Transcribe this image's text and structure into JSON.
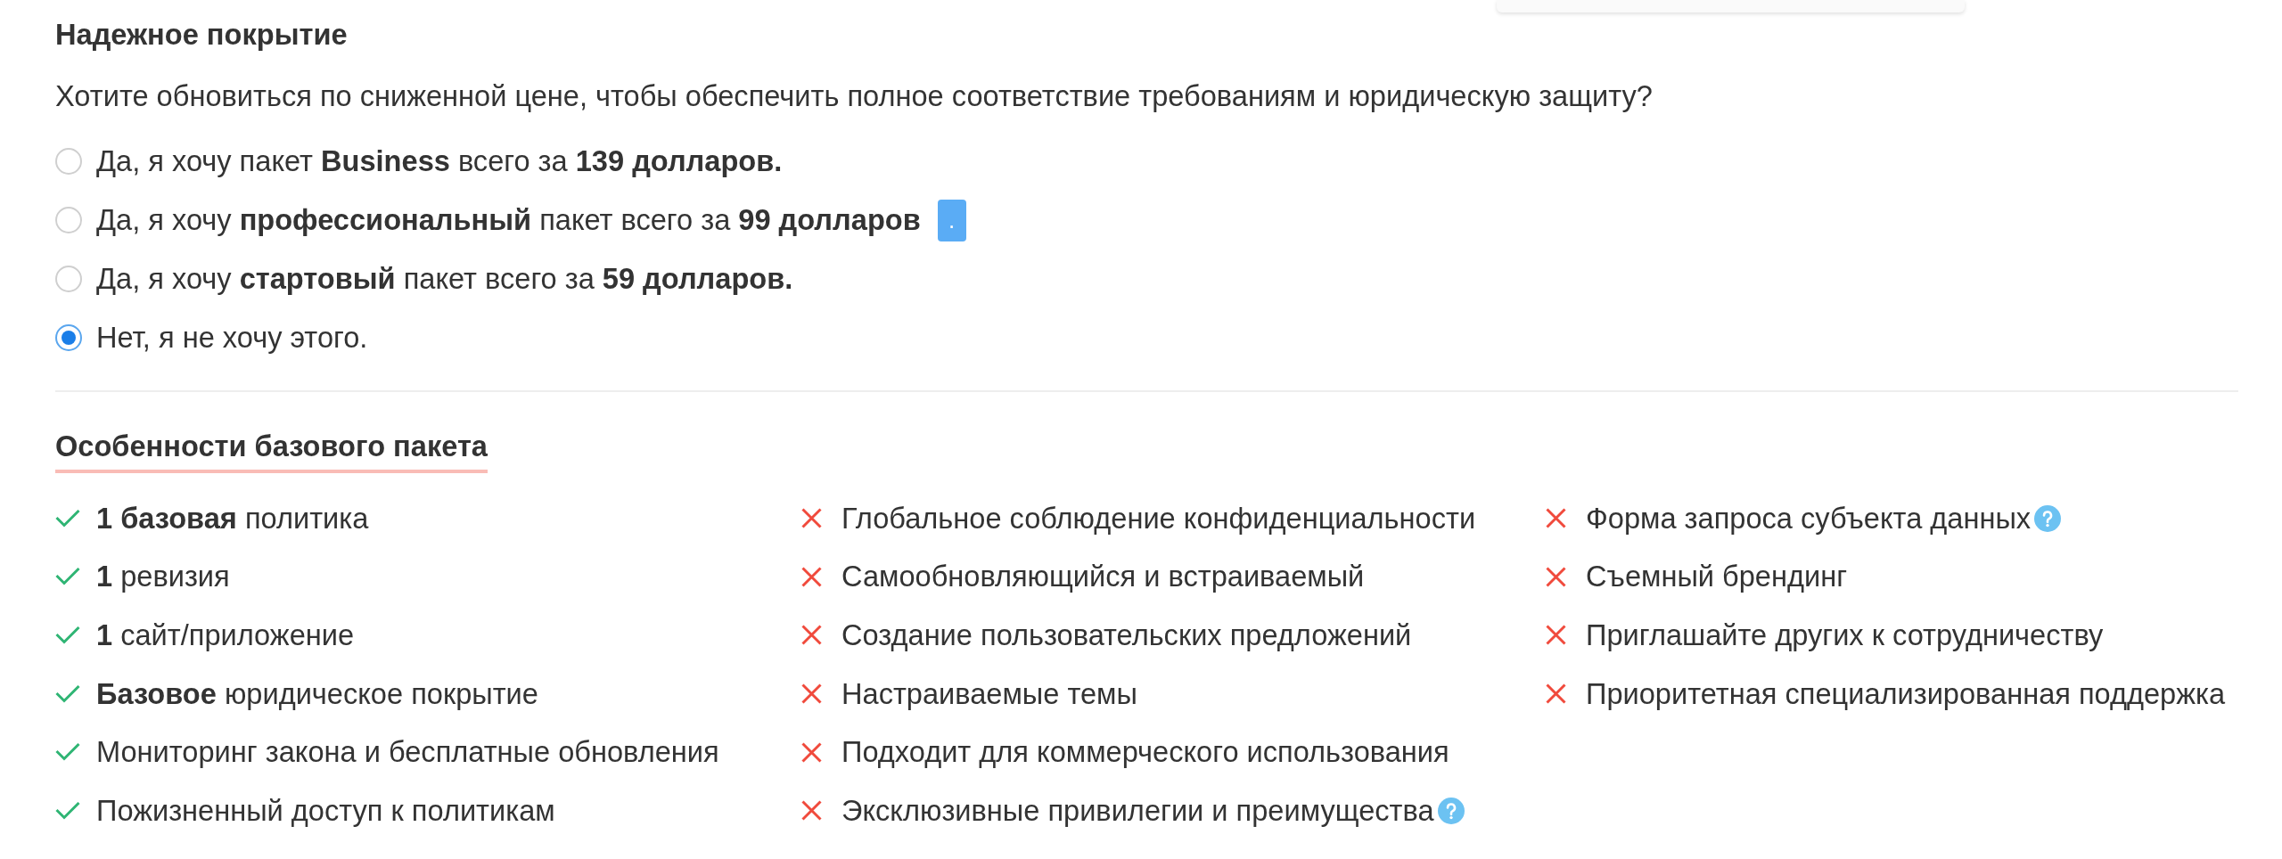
{
  "upgrade": {
    "title": "Надежное покрытие",
    "question": "Хотите обновиться по сниженной цене, чтобы обеспечить полное соответствие требованиям и юридическую защиту?",
    "options": [
      {
        "label": "Да, я хочу пакет **Business** всего за **139 долларов.**",
        "selected": false
      },
      {
        "label": "Да, я хочу **профессиональный** пакет всего за **99 долларов**",
        "badge": ".",
        "selected": false
      },
      {
        "label": "Да, я хочу **стартовый** пакет всего за **59 долларов.**",
        "selected": false
      },
      {
        "label": "Нет, я не хочу этого.",
        "selected": true
      }
    ]
  },
  "features": {
    "title": "Особенности базового пакета",
    "columns": [
      {
        "items": [
          {
            "text": "**1 базовая** политика",
            "included": true,
            "help": false
          },
          {
            "text": "**1** ревизия",
            "included": true,
            "help": false
          },
          {
            "text": "**1** сайт/приложение",
            "included": true,
            "help": false
          },
          {
            "text": "**Базовое** юридическое покрытие",
            "included": true,
            "help": false
          },
          {
            "text": "Мониторинг закона и бесплатные обновления",
            "included": true,
            "help": false
          },
          {
            "text": "Пожизненный доступ к политикам",
            "included": true,
            "help": false
          }
        ]
      },
      {
        "items": [
          {
            "text": "Глобальное соблюдение конфиденциальности",
            "included": false,
            "help": false
          },
          {
            "text": "Самообновляющийся и встраиваемый",
            "included": false,
            "help": false
          },
          {
            "text": "Создание пользовательских предложений",
            "included": false,
            "help": false
          },
          {
            "text": "Настраиваемые темы",
            "included": false,
            "help": false
          },
          {
            "text": "Подходит для коммерческого использования",
            "included": false,
            "help": false
          },
          {
            "text": "Эксклюзивные привилегии и преимущества",
            "included": false,
            "help": true
          }
        ]
      },
      {
        "items": [
          {
            "text": "Форма запроса субъекта данных",
            "included": false,
            "help": true
          },
          {
            "text": "Съемный брендинг",
            "included": false,
            "help": false
          },
          {
            "text": "Приглашайте других к сотрудничеству",
            "included": false,
            "help": false
          },
          {
            "text": "Приоритетная специализированная поддержка",
            "included": false,
            "help": false
          }
        ]
      }
    ]
  }
}
